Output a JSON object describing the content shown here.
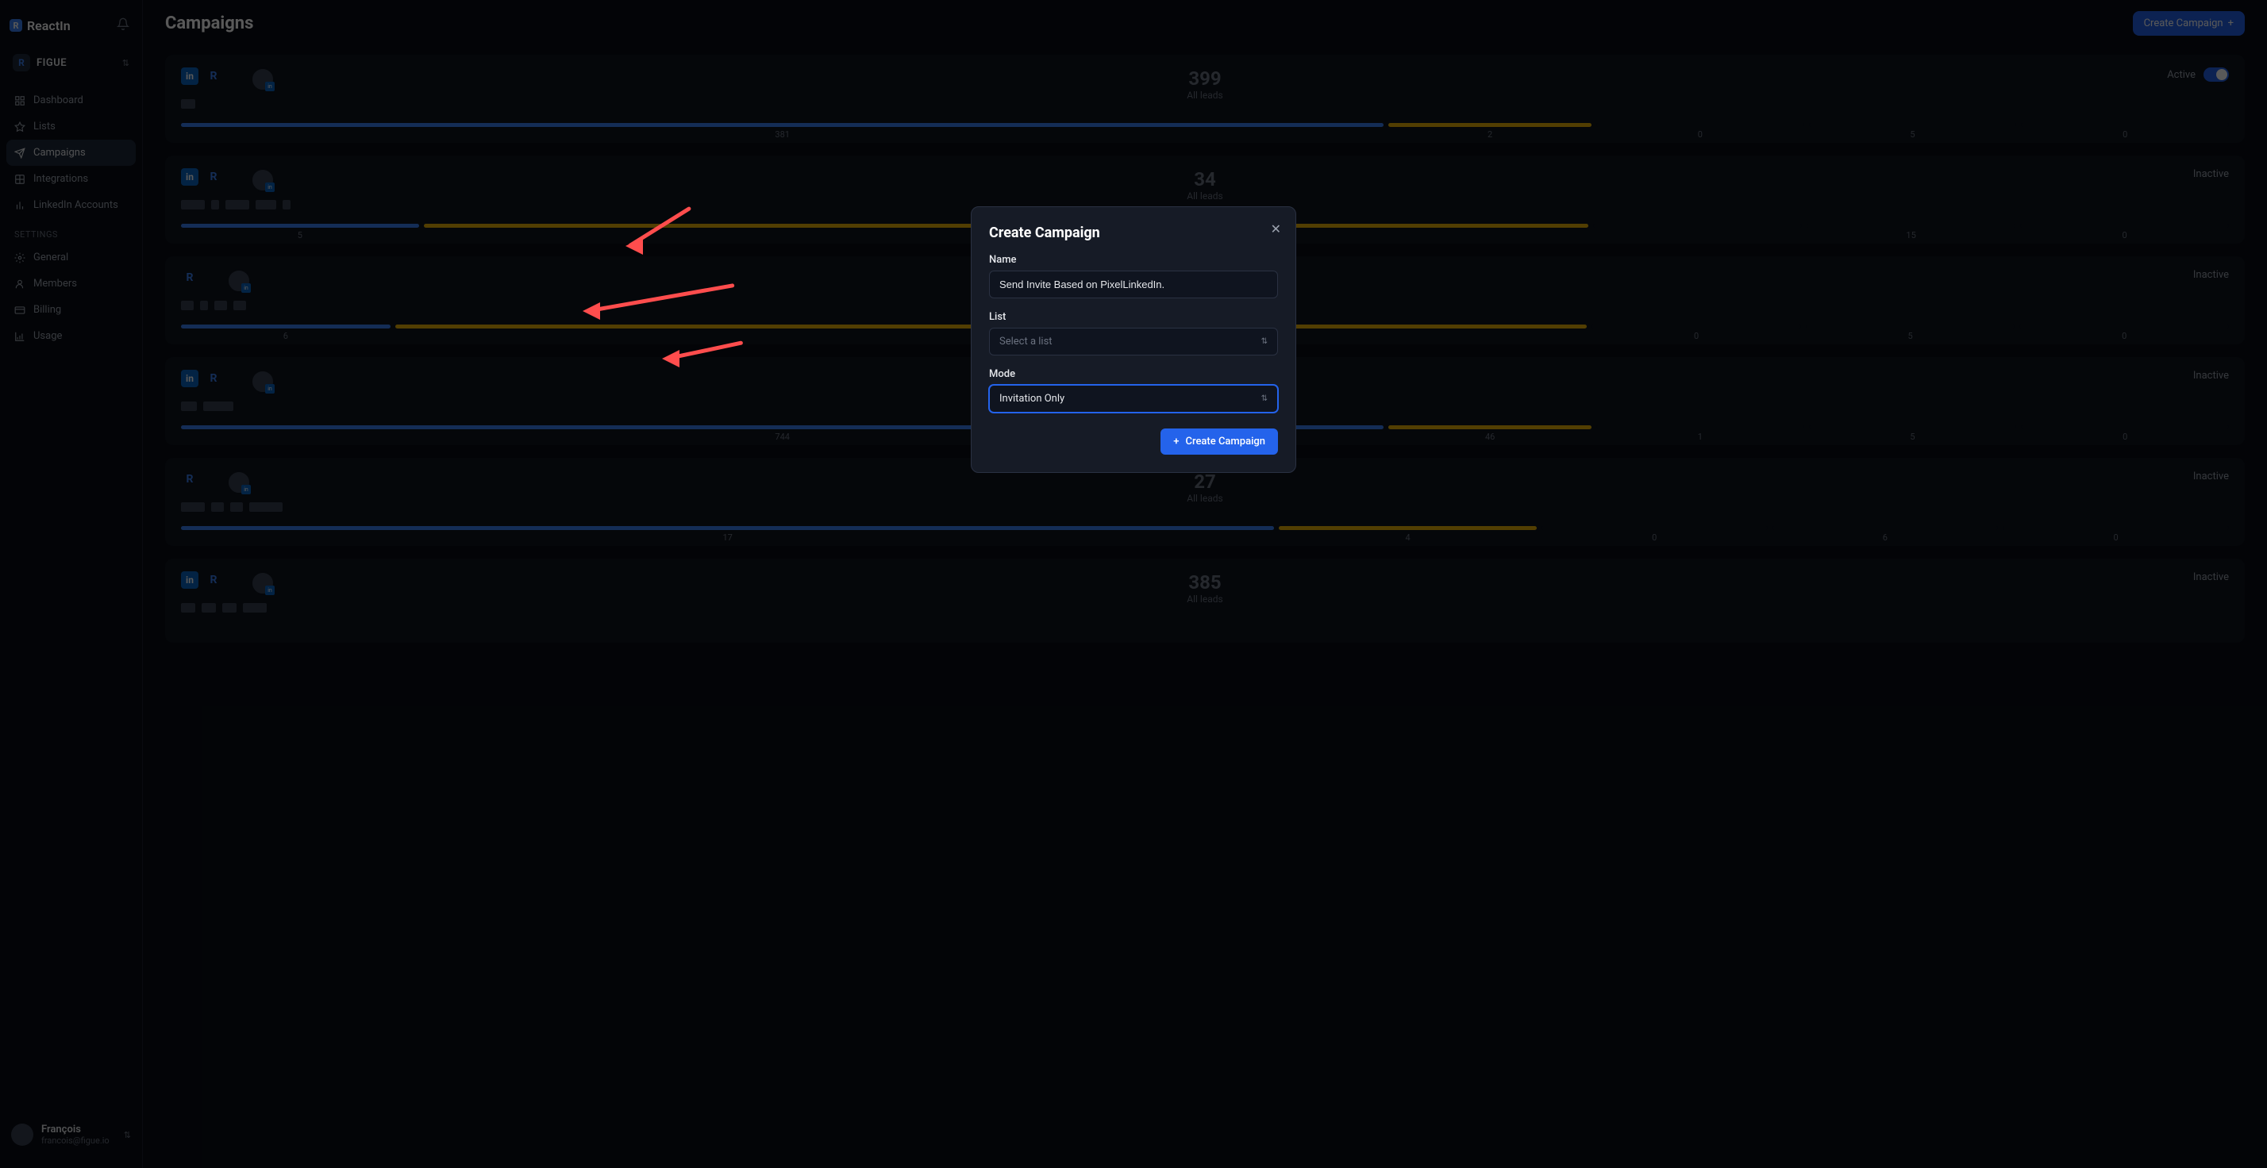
{
  "brand": "ReactIn",
  "org": {
    "name": "FIGUE"
  },
  "nav": {
    "items": [
      {
        "label": "Dashboard"
      },
      {
        "label": "Lists"
      },
      {
        "label": "Campaigns"
      },
      {
        "label": "Integrations"
      },
      {
        "label": "LinkedIn Accounts"
      }
    ],
    "settings_label": "SETTINGS",
    "settings": [
      {
        "label": "General"
      },
      {
        "label": "Members"
      },
      {
        "label": "Billing"
      },
      {
        "label": "Usage"
      }
    ]
  },
  "user": {
    "name": "François",
    "email": "francois@figue.io"
  },
  "page": {
    "title": "Campaigns",
    "create_btn": "Create Campaign"
  },
  "statuses": {
    "active": "Active",
    "inactive": "Inactive"
  },
  "campaigns": [
    {
      "leads": "399",
      "leads_label": "All leads",
      "status": "Active",
      "bars": [
        {
          "w": 49.8,
          "c": "#3b82f6",
          "v": "381"
        },
        {
          "w": 8.4,
          "c": "#eab308",
          "v": "2"
        },
        {
          "w": 8.6,
          "c": "#0f141f",
          "v": "0"
        },
        {
          "w": 8.6,
          "c": "#0f141f",
          "v": "5"
        },
        {
          "w": 8.6,
          "c": "#0f141f",
          "v": "0"
        }
      ],
      "redacts": [
        18,
        0,
        0,
        0,
        0
      ],
      "avatars": 1,
      "li": true,
      "r": true
    },
    {
      "leads": "34",
      "leads_label": "All leads",
      "status": "Inactive",
      "bars": [
        {
          "w": 9.8,
          "c": "#3b82f6",
          "v": "5"
        },
        {
          "w": 48,
          "c": "#eab308",
          "v": ""
        },
        {
          "w": 8.6,
          "c": "#0f141f",
          "v": ""
        },
        {
          "w": 8.6,
          "c": "#0f141f",
          "v": "15"
        },
        {
          "w": 8.6,
          "c": "#0f141f",
          "v": "0"
        }
      ],
      "redacts": [
        30,
        10,
        30,
        26,
        10
      ],
      "avatars": 1,
      "li": true,
      "r": true
    },
    {
      "leads": "",
      "leads_label": "",
      "status": "Inactive",
      "bars": [
        {
          "w": 8.6,
          "c": "#3b82f6",
          "v": "6"
        },
        {
          "w": 49,
          "c": "#eab308",
          "v": ""
        },
        {
          "w": 8.6,
          "c": "#0f141f",
          "v": "0"
        },
        {
          "w": 8.6,
          "c": "#0f141f",
          "v": "5"
        },
        {
          "w": 8.6,
          "c": "#0f141f",
          "v": "0"
        }
      ],
      "redacts": [
        16,
        10,
        16,
        16
      ],
      "avatars": 1,
      "li": false,
      "r": true
    },
    {
      "leads": "",
      "leads_label": "",
      "status": "Inactive",
      "bars": [
        {
          "w": 49.8,
          "c": "#3b82f6",
          "v": "744"
        },
        {
          "w": 8.4,
          "c": "#eab308",
          "v": "46"
        },
        {
          "w": 8.6,
          "c": "#0f141f",
          "v": "1"
        },
        {
          "w": 8.6,
          "c": "#0f141f",
          "v": "5"
        },
        {
          "w": 8.6,
          "c": "#0f141f",
          "v": "0"
        }
      ],
      "redacts": [
        20,
        38
      ],
      "avatars": 1,
      "li": true,
      "r": true
    },
    {
      "leads": "27",
      "leads_label": "All leads",
      "status": "Inactive",
      "bars": [
        {
          "w": 41.6,
          "c": "#3b82f6",
          "v": "17"
        },
        {
          "w": 9.8,
          "c": "#eab308",
          "v": "4"
        },
        {
          "w": 8.6,
          "c": "#0f141f",
          "v": "0"
        },
        {
          "w": 8.6,
          "c": "#0f141f",
          "v": "6"
        },
        {
          "w": 8.6,
          "c": "#0f141f",
          "v": "0"
        }
      ],
      "redacts": [
        30,
        16,
        16,
        42
      ],
      "avatars": 1,
      "li": false,
      "r": true
    },
    {
      "leads": "385",
      "leads_label": "All leads",
      "status": "Inactive",
      "bars": [],
      "redacts": [
        18,
        18,
        18,
        30
      ],
      "avatars": 1,
      "li": true,
      "r": true
    }
  ],
  "modal": {
    "title": "Create Campaign",
    "name_label": "Name",
    "name_value": "Send Invite Based on PixelLinkedIn.",
    "list_label": "List",
    "list_placeholder": "Select a list",
    "mode_label": "Mode",
    "mode_value": "Invitation Only",
    "submit": "Create Campaign"
  }
}
